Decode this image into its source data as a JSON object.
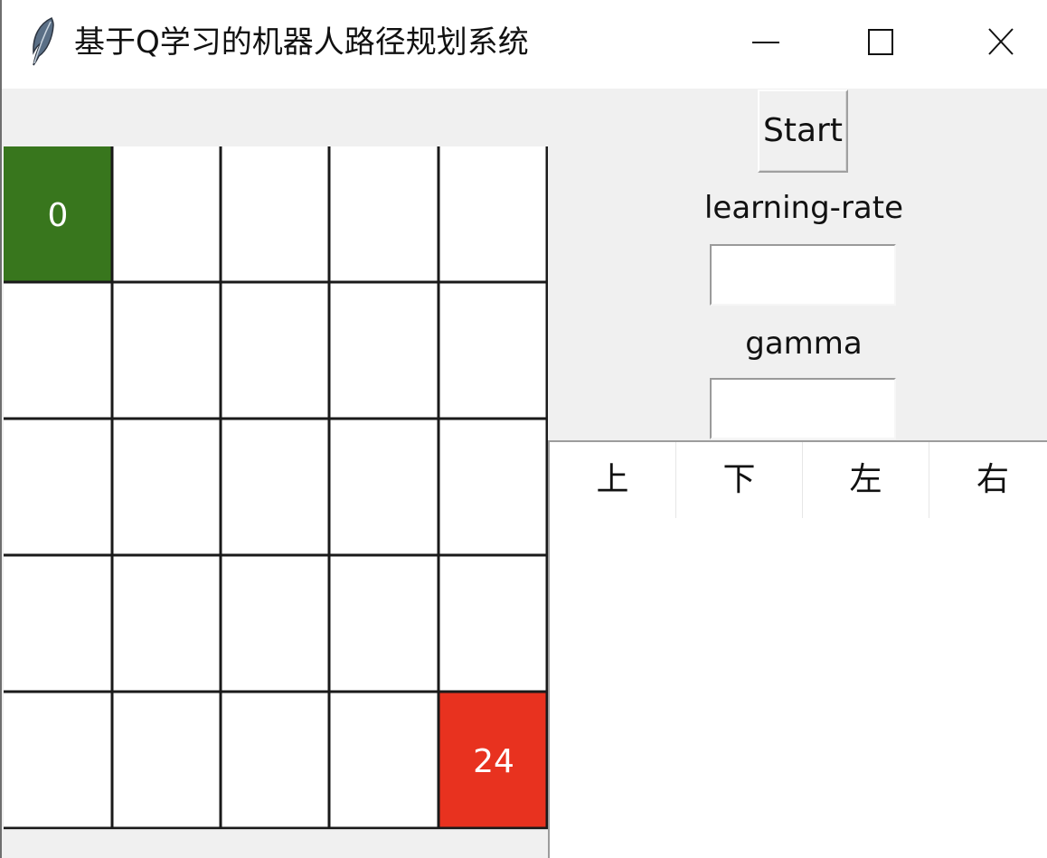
{
  "window": {
    "title": "基于Q学习的机器人路径规划系统",
    "app_icon": "feather-icon",
    "controls": [
      "minimize-icon",
      "maximize-icon",
      "close-icon"
    ]
  },
  "grid": {
    "rows": 5,
    "cols": 5,
    "start_cell": {
      "label": "0",
      "color": "#38761d"
    },
    "goal_cell": {
      "label": "24",
      "color": "#e8321f"
    }
  },
  "controls": {
    "start_label": "Start",
    "learning_rate_label": "learning-rate",
    "learning_rate_value": "",
    "gamma_label": "gamma",
    "gamma_value": ""
  },
  "qtable": {
    "columns": [
      "上",
      "下",
      "左",
      "右"
    ]
  }
}
